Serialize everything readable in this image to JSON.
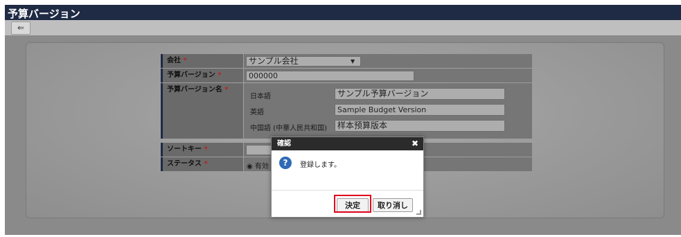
{
  "window": {
    "title": "予算バージョン"
  },
  "toolbar": {
    "back_icon": "arrow-left-icon",
    "back_glyph": "⇐"
  },
  "form": {
    "company": {
      "label": "会社",
      "required": "*",
      "value": "サンプル会社",
      "dropdown_glyph": "▼"
    },
    "version": {
      "label": "予算バージョン",
      "required": "*",
      "value": "000000"
    },
    "version_name": {
      "label": "予算バージョン名",
      "required": "*",
      "locales": [
        {
          "lang": "日本語",
          "value": "サンプル予算バージョン"
        },
        {
          "lang": "英語",
          "value": "Sample Budget Version"
        },
        {
          "lang": "中国語 (中華人民共和国)",
          "value": "样本预算版本"
        }
      ]
    },
    "sort_key": {
      "label": "ソートキー",
      "required": "*",
      "value": ""
    },
    "status": {
      "label": "ステータス",
      "required": "*",
      "value": "有効",
      "radio_glyph": "◉"
    }
  },
  "dialog": {
    "title": "確認",
    "close_glyph": "✖",
    "icon": "question-icon",
    "icon_glyph": "?",
    "message": "登録します。",
    "ok_label": "決定",
    "cancel_label": "取り消し"
  },
  "colors": {
    "titlebar": "#1f2a44",
    "highlight": "#e0001b",
    "dialog_title": "#2b2b2b",
    "question_icon": "#3069b7"
  }
}
